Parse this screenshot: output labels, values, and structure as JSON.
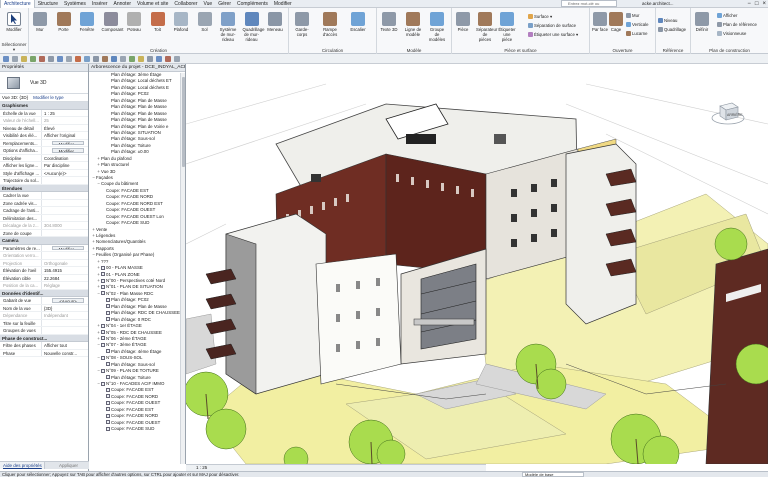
{
  "titlebar": {
    "tabs": [
      "Architecture",
      "Structure",
      "Systèmes",
      "Insérer",
      "Annoter",
      "Volume et site",
      "Collaborer",
      "Vue",
      "Gérer",
      "Compléments",
      "Modifier"
    ],
    "search_placeholder": "Entrez mot-clé ou expression",
    "user": "acke.architect..."
  },
  "ribbon": {
    "modifier_label": "Modifier",
    "selection_label": "Sélectionner ▾",
    "construction_buttons": [
      "Mur",
      "Porte",
      "Fenêtre",
      "Composant",
      "Poteau",
      "Toit",
      "Plafond",
      "Sol",
      "Système de mur-rideau",
      "Quadrillage de mur-rideau",
      "Meneau"
    ],
    "construction_label": "Création",
    "circulation_buttons": [
      "Garde-corps",
      "Rampe d'accès",
      "Escalier"
    ],
    "circulation_label": "Circulation",
    "modele_buttons": [
      "Texte 3D",
      "Ligne de modèle",
      "Groupe de modèles"
    ],
    "modele_label": "Modèle",
    "piece_small": [
      "Pièce",
      "Séparateur de pièces",
      "Étiqueter une pièce"
    ],
    "surface_small": [
      "Surface ▾",
      "Séparation de surface",
      "Étiqueter une surface ▾"
    ],
    "piece_label": "Pièce et surface",
    "ouverture_buttons": [
      "Par face",
      "Cage"
    ],
    "ouverture_small": [
      "Mur",
      "Verticale",
      "Lucarne"
    ],
    "ouverture_label": "Ouverture",
    "niveau": [
      "Niveau",
      "Quadrillage"
    ],
    "reference_label": "Référence",
    "plan_buttons": [
      "Définir",
      "Afficher",
      "Plan de référence",
      "Visionneuse"
    ],
    "plan_label": "Plan de construction"
  },
  "properties": {
    "title": "Propriétés",
    "type_label": "Vue 3D",
    "selector": "Vue 3D: {3D}",
    "edit_type": "Modifier le type",
    "sections": [
      {
        "name": "Graphismes",
        "rows": [
          {
            "k": "Échelle de la vue",
            "v": "1 : 25",
            "kind": "field"
          },
          {
            "k": "Valeur de l'échell...",
            "v": "25",
            "kind": "gray"
          },
          {
            "k": "Niveau de détail",
            "v": "Élevé",
            "kind": "text"
          },
          {
            "k": "Visibilité des élé...",
            "v": "Afficher l'original",
            "kind": "text"
          },
          {
            "k": "Remplacements...",
            "v": "Modifier...",
            "kind": "btn"
          },
          {
            "k": "Options d'afficha...",
            "v": "Modifier...",
            "kind": "btn"
          },
          {
            "k": "Discipline",
            "v": "Coordination",
            "kind": "text"
          },
          {
            "k": "Afficher les ligne...",
            "v": "Par discipline",
            "kind": "text"
          },
          {
            "k": "Style d'affichage ...",
            "v": "<Aucun(e)>",
            "kind": "text"
          },
          {
            "k": "Trajectoire du sol...",
            "v": "",
            "kind": "text"
          }
        ]
      },
      {
        "name": "Étendues",
        "rows": [
          {
            "k": "Cadrer la vue",
            "v": "",
            "kind": "text"
          },
          {
            "k": "Zone cadrée vis...",
            "v": "",
            "kind": "text"
          },
          {
            "k": "Cadrage de l'anti...",
            "v": "",
            "kind": "text"
          },
          {
            "k": "Délimitation des...",
            "v": "",
            "kind": "text"
          },
          {
            "k": "Décalage de la z...",
            "v": "304.8000",
            "kind": "gray"
          },
          {
            "k": "Zone de coupe",
            "v": "",
            "kind": "text"
          }
        ]
      },
      {
        "name": "Caméra",
        "rows": [
          {
            "k": "Paramètres de re...",
            "v": "Modifier...",
            "kind": "btn"
          },
          {
            "k": "Orientation verro...",
            "v": "",
            "kind": "gray"
          },
          {
            "k": "Projection",
            "v": "Orthogonale",
            "kind": "gray"
          },
          {
            "k": "Élévation de l'oeil",
            "v": "155.4915",
            "kind": "text"
          },
          {
            "k": "Élévation cible",
            "v": "22.2684",
            "kind": "text"
          },
          {
            "k": "Position de la ca...",
            "v": "Réglage",
            "kind": "gray"
          }
        ]
      },
      {
        "name": "Données d'identif...",
        "rows": [
          {
            "k": "Gabarit de vue",
            "v": "<Aucun>",
            "kind": "btn"
          },
          {
            "k": "Nom de la vue",
            "v": "{3D}",
            "kind": "text"
          },
          {
            "k": "Dépendance",
            "v": "Indépendant",
            "kind": "gray"
          },
          {
            "k": "Titre sur la feuille",
            "v": "",
            "kind": "text"
          },
          {
            "k": "Groupes de vues",
            "v": "",
            "kind": "text"
          }
        ]
      },
      {
        "name": "Phase de construct...",
        "rows": [
          {
            "k": "Filtre des phases",
            "v": "Afficher tout",
            "kind": "text"
          },
          {
            "k": "Phase",
            "v": "Nouvelle constr...",
            "kind": "text"
          }
        ]
      }
    ],
    "help_link": "Aide des propriétés",
    "apply": "Appliquer"
  },
  "browser": {
    "title": "Arborescence du projet - DCE_INDYAL_ACP...",
    "nodes": [
      {
        "d": 3,
        "t": "Plan d'étage: 3ème Étage",
        "i": false
      },
      {
        "d": 3,
        "t": "Plan d'étage: Local déchets ET",
        "i": false
      },
      {
        "d": 3,
        "t": "Plan d'étage: Local déchets E",
        "i": false
      },
      {
        "d": 3,
        "t": "Plan d'étage: PC02",
        "i": false
      },
      {
        "d": 3,
        "t": "Plan d'étage: Plan de Masse",
        "i": false
      },
      {
        "d": 3,
        "t": "Plan d'étage: Plan de Masse",
        "i": false
      },
      {
        "d": 3,
        "t": "Plan d'étage: Plan de Masse",
        "i": false
      },
      {
        "d": 3,
        "t": "Plan d'étage: Plan de Masse",
        "i": false
      },
      {
        "d": 3,
        "t": "Plan d'étage: Plan de Voirie e",
        "i": false
      },
      {
        "d": 3,
        "t": "Plan d'étage: SITUATION",
        "i": false
      },
      {
        "d": 3,
        "t": "Plan d'étage: Sous-sol",
        "i": false
      },
      {
        "d": 3,
        "t": "Plan d'étage: Toiture",
        "i": false
      },
      {
        "d": 3,
        "t": "Plan d'étage: ±0.00",
        "i": false
      },
      {
        "d": 1,
        "t": "Plan du plafond",
        "i": false,
        "tog": "+"
      },
      {
        "d": 1,
        "t": "Plan structurel",
        "i": false,
        "tog": "+"
      },
      {
        "d": 1,
        "t": "Vue 3D",
        "i": false,
        "tog": "+"
      },
      {
        "d": 0,
        "t": "Façades",
        "i": false,
        "tog": "−"
      },
      {
        "d": 1,
        "t": "Coupe du bâtiment",
        "i": false,
        "tog": "−"
      },
      {
        "d": 2,
        "t": "Coupe: FACADE EST",
        "i": false
      },
      {
        "d": 2,
        "t": "Coupe: FACADE NORD",
        "i": false
      },
      {
        "d": 2,
        "t": "Coupe: FACADE NORD EST",
        "i": false
      },
      {
        "d": 2,
        "t": "Coupe: FACADE OUEST",
        "i": false
      },
      {
        "d": 2,
        "t": "Coupe: FACADE OUEST Lon",
        "i": false
      },
      {
        "d": 2,
        "t": "Coupe: FACADE SUD",
        "i": false
      },
      {
        "d": 0,
        "t": "Vente",
        "i": false,
        "tog": "+"
      },
      {
        "d": 0,
        "t": "Légendes",
        "i": false,
        "tog": "+"
      },
      {
        "d": 0,
        "t": "Nomenclatures/Quantités",
        "i": false,
        "tog": "+"
      },
      {
        "d": 0,
        "t": "Rapports",
        "i": false,
        "tog": "+"
      },
      {
        "d": 0,
        "t": "Feuilles (Organisé par Phase)",
        "i": false,
        "tog": "−"
      },
      {
        "d": 1,
        "t": "???",
        "i": false,
        "tog": "+"
      },
      {
        "d": 1,
        "t": "00 - PLAN MASSE",
        "i": true,
        "tog": "+"
      },
      {
        "d": 1,
        "t": "01 - PLAN ZONE",
        "i": true,
        "tog": "+"
      },
      {
        "d": 1,
        "t": "N°00 - Perspectives coté Nord",
        "i": true,
        "tog": "+"
      },
      {
        "d": 1,
        "t": "N°01 - PLAN DE SITUATION",
        "i": true,
        "tog": "+"
      },
      {
        "d": 1,
        "t": "N°02 - Plan Masse RDC",
        "i": true,
        "tog": "−"
      },
      {
        "d": 2,
        "t": "Plan d'étage: PC02",
        "i": true
      },
      {
        "d": 2,
        "t": "Plan d'étage: Plan de Masse",
        "i": true
      },
      {
        "d": 2,
        "t": "Plan d'étage: RDC DE CHAUSSEE",
        "i": true
      },
      {
        "d": 2,
        "t": "Plan d'étage: 0 RDC",
        "i": true
      },
      {
        "d": 1,
        "t": "N°04 - 1er ÉTAGE",
        "i": true,
        "tog": "+"
      },
      {
        "d": 1,
        "t": "N°05 - RDC DE CHAUSSEE",
        "i": true,
        "tog": "+"
      },
      {
        "d": 1,
        "t": "N°06 - 2ème ÉTAGE",
        "i": true,
        "tog": "+"
      },
      {
        "d": 1,
        "t": "N°07 - 3ème ÉTAGE",
        "i": true,
        "tog": "−"
      },
      {
        "d": 2,
        "t": "Plan d'étage: 4ème Étage",
        "i": true
      },
      {
        "d": 1,
        "t": "N°08 - SOUS-SOL",
        "i": true,
        "tog": "−"
      },
      {
        "d": 2,
        "t": "Plan d'étage: Sous-sol",
        "i": true
      },
      {
        "d": 1,
        "t": "N°09 - PLAN DE TOITURE",
        "i": true,
        "tog": "−"
      },
      {
        "d": 2,
        "t": "Plan d'étage: Toiture",
        "i": true
      },
      {
        "d": 1,
        "t": "N°10 - FACADES ACIF IMMO",
        "i": true,
        "tog": "−"
      },
      {
        "d": 2,
        "t": "Coupe: FACADE EST",
        "i": true
      },
      {
        "d": 2,
        "t": "Coupe: FACADE NORD",
        "i": true
      },
      {
        "d": 2,
        "t": "Coupe: FACADE OUEST",
        "i": true
      },
      {
        "d": 2,
        "t": "Coupe: FACADE EST",
        "i": true
      },
      {
        "d": 2,
        "t": "Coupe: FACADE NORD",
        "i": true
      },
      {
        "d": 2,
        "t": "Coupe: FACADE OUEST",
        "i": true
      },
      {
        "d": 2,
        "t": "Coupe: FACADE SUD",
        "i": true
      }
    ]
  },
  "viewport": {
    "viewcube_label": "ARRIÈRE",
    "viewbar_scale": "1 : 25"
  },
  "statusbar": {
    "text": "Cliquer pour sélectionner; Appuyez sur TAB pour afficher d'autres options, sur CTRL pour ajouter et sur MAJ pour désactiver.",
    "model": "Modèle de base"
  },
  "colors": {
    "accent": "#1a3f8a",
    "brick": "#6b2a22",
    "roof": "#f4f4f0",
    "ground": "#f2f0a6",
    "tree": "#a7d94a"
  }
}
